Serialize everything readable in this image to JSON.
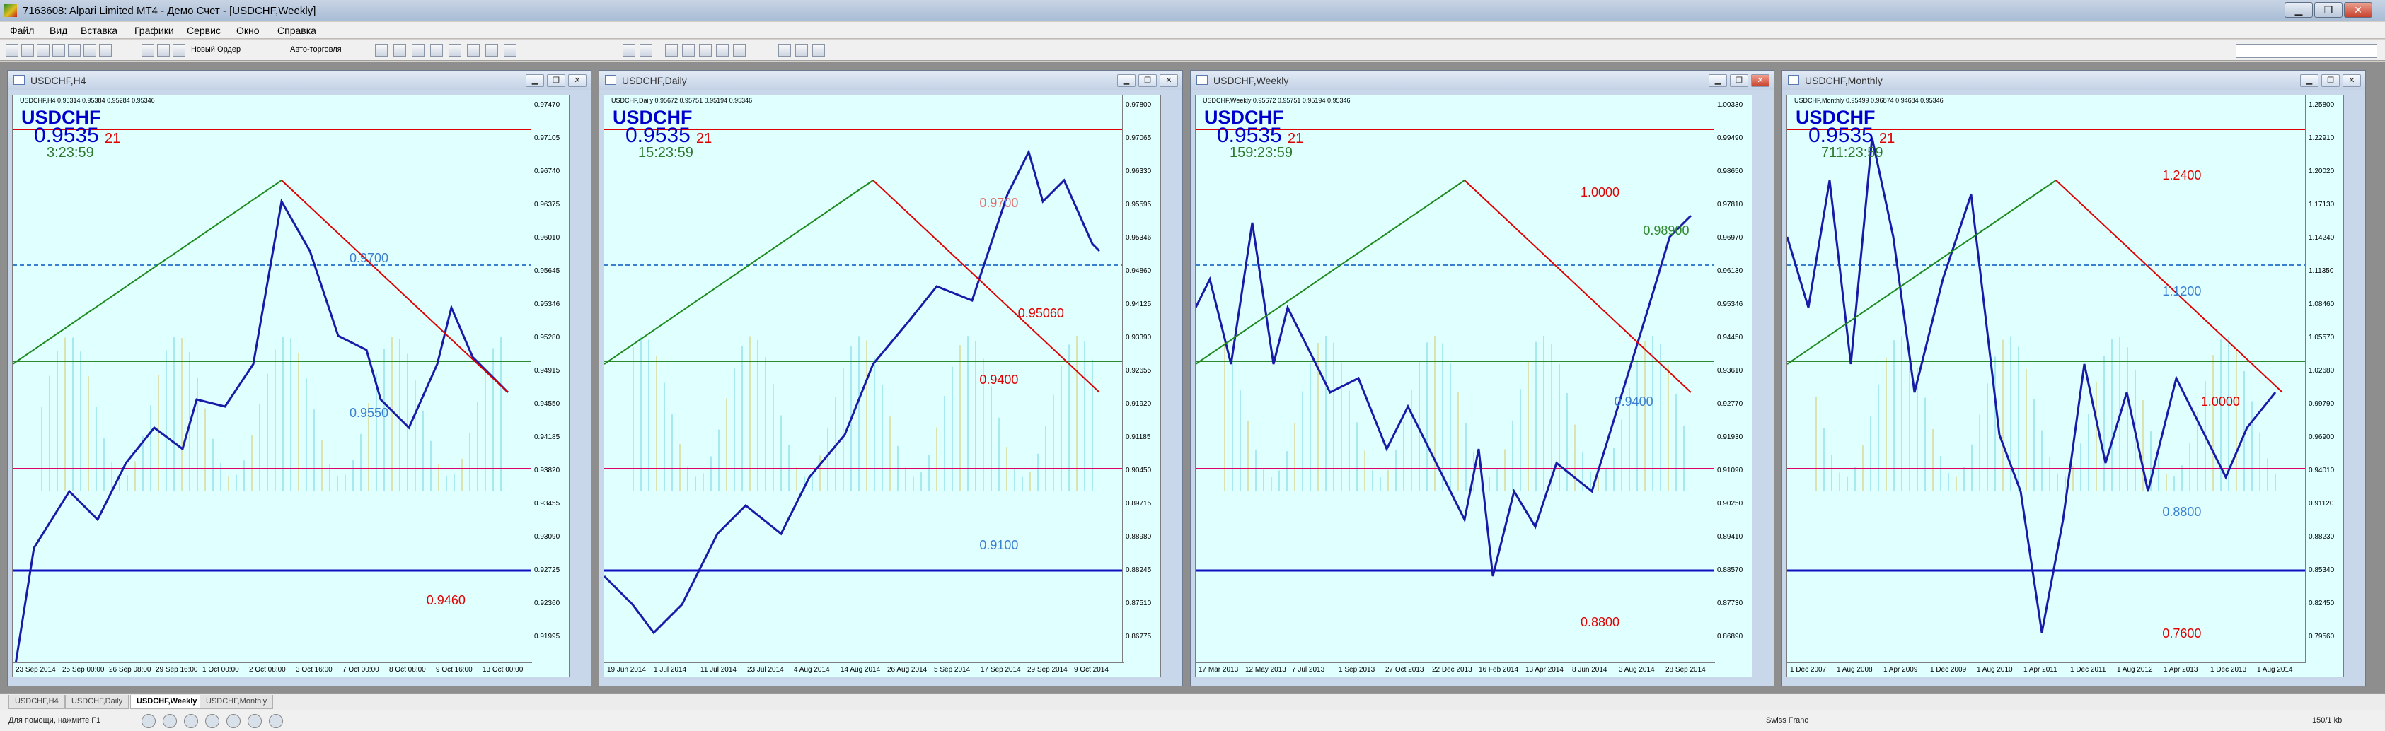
{
  "window": {
    "title": "7163608: Alpari Limited MT4 - Демо Счет - [USDCHF,Weekly]",
    "min_label": "▁",
    "max_label": "❐",
    "close_label": "✕"
  },
  "menu": [
    "Файл",
    "Вид",
    "Вставка",
    "Графики",
    "Сервис",
    "Окно",
    "Справка"
  ],
  "toolbar": {
    "new_order": "Новый Ордер",
    "auto_trading": "Авто-торговля",
    "icons": [
      "new-chart-icon",
      "profiles-icon",
      "navigator-icon",
      "market-watch-icon",
      "data-window-icon",
      "terminal-icon",
      "tester-icon",
      "bar-chart-icon",
      "candle-chart-icon",
      "line-chart-icon",
      "zoom-in-icon",
      "zoom-out-icon",
      "tile-icon",
      "autoscroll-icon",
      "shift-icon",
      "indicators-icon",
      "periods-icon",
      "templates-icon",
      "cursor-icon",
      "crosshair-icon",
      "vline-icon",
      "hline-icon",
      "trendline-icon",
      "channel-icon",
      "fibo-icon",
      "text-icon",
      "label-icon",
      "arrows-icon"
    ]
  },
  "charts": [
    {
      "caption": "USDCHF,H4",
      "ohlc": "USDCHF,H4  0.95314 0.95384 0.95284 0.95346",
      "symbol": "USDCHF",
      "bid": "0.9535",
      "bid_sup": "21",
      "timer": "3:23:59",
      "levels": [
        {
          "text": "0.9700",
          "color": "#3a7fd0"
        },
        {
          "text": "0.9550",
          "color": "#3a7fd0"
        },
        {
          "text": "0.9460",
          "color": "#e00000"
        }
      ],
      "ticks": [
        "0.97470",
        "0.97105",
        "0.96740",
        "0.96375",
        "0.96010",
        "0.95645",
        "0.95346",
        "0.95280",
        "0.94915",
        "0.94550",
        "0.94185",
        "0.93820",
        "0.93455",
        "0.93090",
        "0.92725",
        "0.92360",
        "0.91995"
      ],
      "dates": [
        "23 Sep 2014",
        "25 Sep 00:00",
        "26 Sep 08:00",
        "29 Sep 16:00",
        "1 Oct 00:00",
        "2 Oct 08:00",
        "3 Oct 16:00",
        "7 Oct 00:00",
        "8 Oct 08:00",
        "9 Oct 16:00",
        "13 Oct 00:00"
      ]
    },
    {
      "caption": "USDCHF,Daily",
      "ohlc": "USDCHF,Daily  0.95672 0.95751 0.95194 0.95346",
      "symbol": "USDCHF",
      "bid": "0.9535",
      "bid_sup": "21",
      "timer": "15:23:59",
      "levels": [
        {
          "text": "0.9700",
          "color": "#e07070"
        },
        {
          "text": "0.9400",
          "color": "#e00000"
        },
        {
          "text": "0.9100",
          "color": "#3a7fd0"
        },
        {
          "text": "0.95060",
          "color": "#e00000"
        }
      ],
      "ticks": [
        "0.97800",
        "0.97065",
        "0.96330",
        "0.95595",
        "0.95346",
        "0.94860",
        "0.94125",
        "0.93390",
        "0.92655",
        "0.91920",
        "0.91185",
        "0.90450",
        "0.89715",
        "0.88980",
        "0.88245",
        "0.87510",
        "0.86775"
      ],
      "dates": [
        "19 Jun 2014",
        "1 Jul 2014",
        "11 Jul 2014",
        "23 Jul 2014",
        "4 Aug 2014",
        "14 Aug 2014",
        "26 Aug 2014",
        "5 Sep 2014",
        "17 Sep 2014",
        "29 Sep 2014",
        "9 Oct 2014"
      ]
    },
    {
      "caption": "USDCHF,Weekly",
      "ohlc": "USDCHF,Weekly  0.95672 0.95751 0.95194 0.95346",
      "symbol": "USDCHF",
      "bid": "0.9535",
      "bid_sup": "21",
      "timer": "159:23:59",
      "levels": [
        {
          "text": "1.0000",
          "color": "#e00000"
        },
        {
          "text": "0.9400",
          "color": "#3a7fd0"
        },
        {
          "text": "0.8800",
          "color": "#e00000"
        },
        {
          "text": "0.98900",
          "color": "#2d8a2d"
        }
      ],
      "ticks": [
        "1.00330",
        "0.99490",
        "0.98650",
        "0.97810",
        "0.96970",
        "0.96130",
        "0.95346",
        "0.94450",
        "0.93610",
        "0.92770",
        "0.91930",
        "0.91090",
        "0.90250",
        "0.89410",
        "0.88570",
        "0.87730",
        "0.86890"
      ],
      "dates": [
        "17 Mar 2013",
        "12 May 2013",
        "7 Jul 2013",
        "1 Sep 2013",
        "27 Oct 2013",
        "22 Dec 2013",
        "16 Feb 2014",
        "13 Apr 2014",
        "8 Jun 2014",
        "3 Aug 2014",
        "28 Sep 2014"
      ]
    },
    {
      "caption": "USDCHF,Monthly",
      "ohlc": "USDCHF,Monthly  0.95499 0.96874 0.94684 0.95346",
      "symbol": "USDCHF",
      "bid": "0.9535",
      "bid_sup": "21",
      "timer": "711:23:59",
      "levels": [
        {
          "text": "1.2400",
          "color": "#e00000"
        },
        {
          "text": "1.1200",
          "color": "#3a7fd0"
        },
        {
          "text": "1.0000",
          "color": "#e00000"
        },
        {
          "text": "0.8800",
          "color": "#3a7fd0"
        },
        {
          "text": "0.7600",
          "color": "#e00000"
        }
      ],
      "ticks": [
        "1.25800",
        "1.22910",
        "1.20020",
        "1.17130",
        "1.14240",
        "1.11350",
        "1.08460",
        "1.05570",
        "1.02680",
        "0.99790",
        "0.96900",
        "0.94010",
        "0.91120",
        "0.88230",
        "0.85340",
        "0.82450",
        "0.79560"
      ],
      "dates": [
        "1 Dec 2007",
        "1 Aug 2008",
        "1 Apr 2009",
        "1 Dec 2009",
        "1 Aug 2010",
        "1 Apr 2011",
        "1 Dec 2011",
        "1 Aug 2012",
        "1 Apr 2013",
        "1 Dec 2013",
        "1 Aug 2014"
      ]
    }
  ],
  "tabs": [
    "USDCHF,H4",
    "USDCHF,Daily",
    "USDCHF,Weekly",
    "USDCHF,Monthly"
  ],
  "status": {
    "left": "Для помощи, нажмите F1",
    "instrument": "Swiss Franc",
    "traffic": "150/1 kb"
  }
}
